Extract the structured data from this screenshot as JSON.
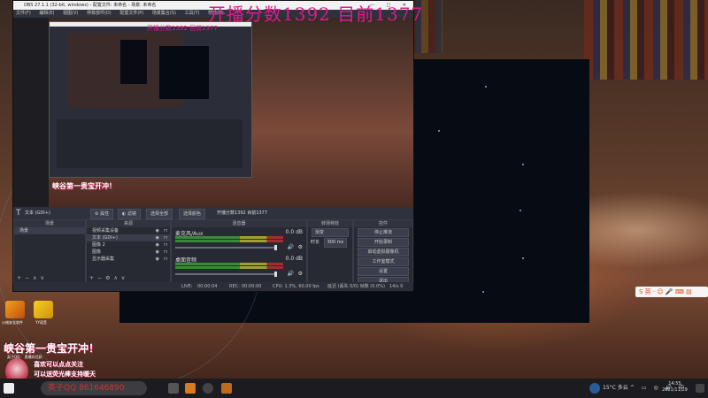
{
  "overlay": {
    "title": "开播分数1392 目前1377",
    "nested_title": "开播分数1392 目前1377"
  },
  "obs": {
    "window_title": "OBS 27.1.1 (32-bit, windows) - 配置文件: 未命名 - 场景: 未命名",
    "window_buttons": "— □ ✕",
    "menu": [
      "文件(F)",
      "编辑(E)",
      "视图(V)",
      "停靠部件(D)",
      "配置文件(P)",
      "场景集合(S)",
      "工具(T)",
      "帮助(H)"
    ],
    "toolbar": {
      "source_name": "文本 (GDI+)",
      "properties": "属性",
      "filters": "滤镜",
      "select_all": "选择全部",
      "select_color": "选择颜色",
      "text_value": "开播分数1392 目前1377"
    },
    "scenes": {
      "header": "场景",
      "items": [
        "场景"
      ]
    },
    "sources": {
      "header": "来源",
      "items": [
        "视频采集设备",
        "文本 (GDI+)",
        "图像 2",
        "图像",
        "显示器采集"
      ]
    },
    "mixer": {
      "header": "混音器",
      "channels": [
        {
          "name": "麦克风/Aux",
          "db": "0.0 dB"
        },
        {
          "name": "桌面音频",
          "db": "0.0 dB"
        }
      ]
    },
    "transitions": {
      "header": "转场特效",
      "type": "渐变",
      "duration_label": "时长",
      "duration": "300 ms"
    },
    "controls": {
      "header": "控件",
      "buttons": [
        "停止推流",
        "开始录制",
        "启动虚拟摄像机",
        "工作室模式",
        "设置",
        "退出"
      ]
    },
    "status": {
      "live_label": "LIVE:",
      "live_time": "00:00:04",
      "rec_label": "REC:",
      "rec_time": "00:00:00",
      "cpu": "CPU: 1.3%, 60.00 fps",
      "dropped": "延迟 (丢失 0/0) 帧数 (0.0%)",
      "kbps": "14/s 0"
    }
  },
  "desktop": {
    "icons": [
      {
        "label": "火绒安全软件"
      },
      {
        "label": "YY语音"
      }
    ],
    "banner1": "峡谷第一贵宝开冲！",
    "banner2_line1": "喜欢可以点点关注",
    "banner2_line2": "可以送荧光棒支持暖天",
    "small_caption": "英子QQ：  直播间活跃",
    "score_strip": "英子QQ 861646890",
    "sogou": "S 英 · ☺ 🎤 ⌨ ▤"
  },
  "taskbar": {
    "weather": "15°C 多云",
    "time": "14:55",
    "date": "2021/11/29"
  },
  "colors": {
    "overlay": "#e01a8e",
    "obs_bg": "#2b2e38",
    "accent_red": "#c0204a"
  }
}
